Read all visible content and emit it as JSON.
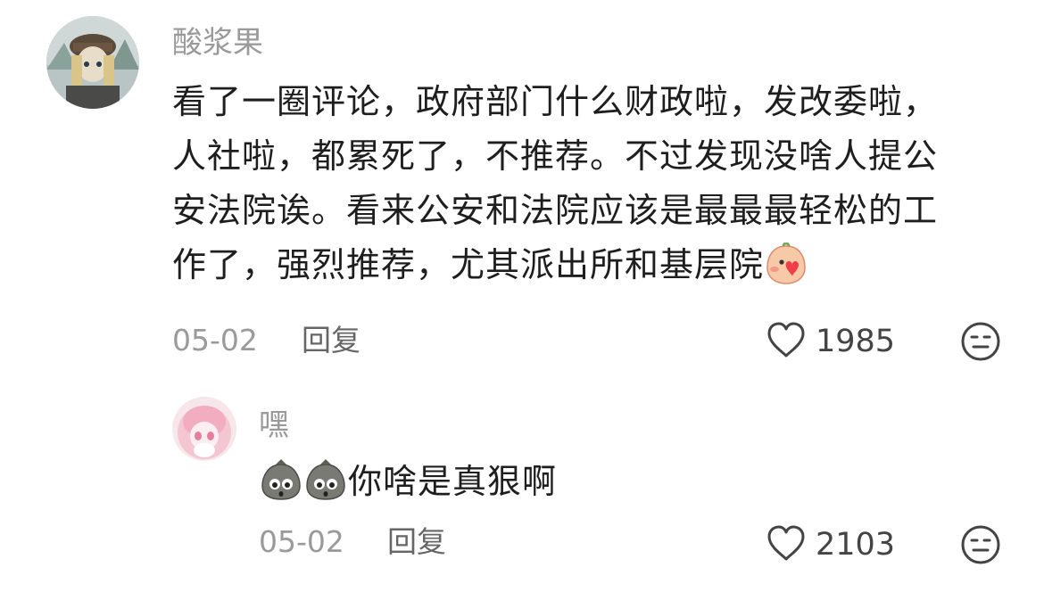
{
  "comments": [
    {
      "username": "酸浆果",
      "text_lines": [
        "看了一圈评论，政府部门什么财政啦，发改委啦，",
        "人社啦，都累死了，不推荐。不过发现没啥人提公",
        "安法院诶。看来公安和法院应该是最最最轻松的工",
        "作了，强烈推荐，尤其派出所和基层院"
      ],
      "emoji": "kiss-emoji",
      "date": "05-02",
      "reply_label": "回复",
      "likes": "1985"
    },
    {
      "username": "嘿",
      "text": "你啥是真狠啊",
      "emojis": [
        "sack-face-emoji",
        "sack-face-emoji"
      ],
      "date": "05-02",
      "reply_label": "回复",
      "likes": "2103"
    }
  ],
  "icons": {
    "like": "heart-outline-icon",
    "dislike": "meh-face-icon"
  },
  "colors": {
    "meta_gray": "#9a9a9a",
    "text": "#1e1e1e",
    "background": "#ffffff"
  }
}
